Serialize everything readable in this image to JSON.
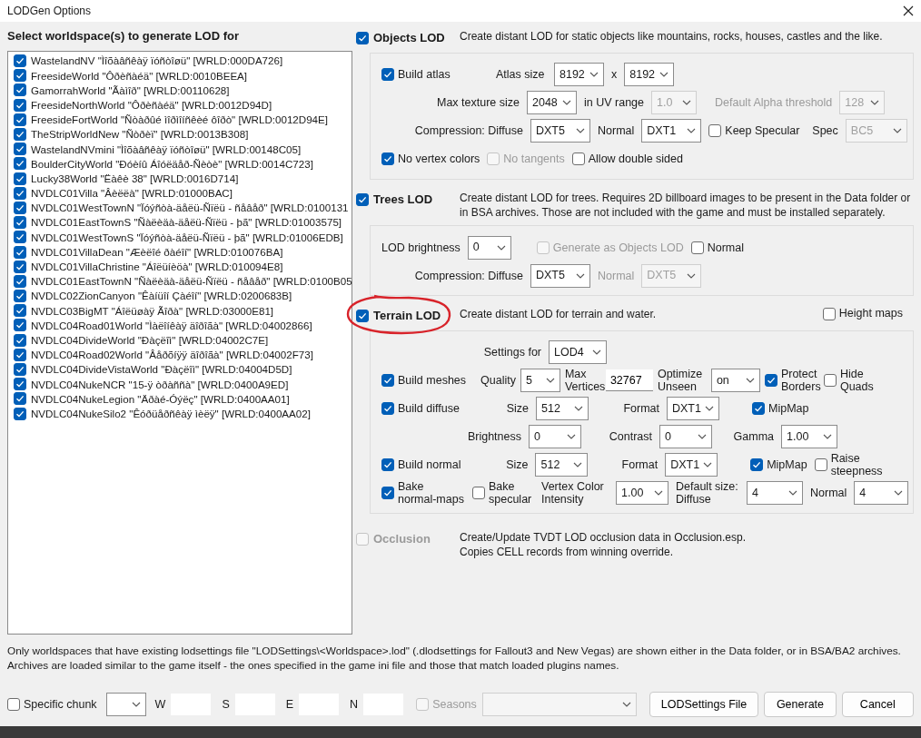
{
  "window": {
    "title": "LODGen Options"
  },
  "worldspaces": {
    "heading": "Select worldspace(s) to generate LOD for",
    "items": [
      {
        "label": "WastelandNV \"Ìîõàâñêàÿ ïóñòîøü\" [WRLD:000DA726]",
        "checked": true
      },
      {
        "label": "FreesideWorld \"Ôðèñàéä\" [WRLD:0010BEEA]",
        "checked": true
      },
      {
        "label": "GamorrahWorld \"Ãàìîð\" [WRLD:00110628]",
        "checked": true
      },
      {
        "label": "FreesideNorthWorld \"Ôðèñàéä\" [WRLD:0012D94D]",
        "checked": true
      },
      {
        "label": "FreesideFortWorld \"Ñòàðûé ìîðìîíñêèé ôîðò\" [WRLD:0012D94E]",
        "checked": true
      },
      {
        "label": "TheStripWorldNew \"Ñòðèï\" [WRLD:0013B308]",
        "checked": true
      },
      {
        "label": "WastelandNVmini \"Ìîõàâñêàÿ ïóñòîøü\" [WRLD:00148C05]",
        "checked": true
      },
      {
        "label": "BoulderCityWorld \"Ðóèíû Áîóëäåð-Ñèòè\" [WRLD:0014C723]",
        "checked": true
      },
      {
        "label": "Lucky38World \"Ëàêè 38\" [WRLD:0016D714]",
        "checked": true
      },
      {
        "label": "NVDLC01Villa \"Âèëëà\" [WRLD:01000BAC]",
        "checked": true
      },
      {
        "label": "NVDLC01WestTownN \"Ïóýñòà-äåëü-Ñïëü - ñåâåð\" [WRLD:0100131",
        "checked": true
      },
      {
        "label": "NVDLC01EastTownS \"Ñàëèäà-äåëü-Ñïëü - þã\" [WRLD:01003575]",
        "checked": true
      },
      {
        "label": "NVDLC01WestTownS \"Ïóýñòà-äåëü-Ñïëü - þã\" [WRLD:01006EDB]",
        "checked": true
      },
      {
        "label": "NVDLC01VillaDean \"Æèëîé ðàéîí\" [WRLD:010076BA]",
        "checked": true
      },
      {
        "label": "NVDLC01VillaChristine \"Áîëüíèöà\" [WRLD:010094E8]",
        "checked": true
      },
      {
        "label": "NVDLC01EastTownN \"Ñàëèäà-äåëü-Ñïëü - ñåâåð\" [WRLD:0100B05",
        "checked": true
      },
      {
        "label": "NVDLC02ZionCanyon \"Êàíüîí Çàéîí\" [WRLD:0200683B]",
        "checked": true
      },
      {
        "label": "NVDLC03BigMT \"Áîëüøàÿ Ãîðà\" [WRLD:03000E81]",
        "checked": true
      },
      {
        "label": "NVDLC04Road01World \"Ìàëîíêàÿ äîðîãà\" [WRLD:04002866]",
        "checked": true
      },
      {
        "label": "NVDLC04DivideWorld \"Ðàçëîì\" [WRLD:04002C7E]",
        "checked": true
      },
      {
        "label": "NVDLC04Road02World \"Âåðõíÿÿ äîðîãà\" [WRLD:04002F73]",
        "checked": true
      },
      {
        "label": "NVDLC04DivideVistaWorld \"Ðàçëîì\" [WRLD:04004D5D]",
        "checked": true
      },
      {
        "label": "NVDLC04NukeNCR \"15-ÿ òðàññà\" [WRLD:0400A9ED]",
        "checked": true
      },
      {
        "label": "NVDLC04NukeLegion \"Äðàé-Óýëç\" [WRLD:0400AA01]",
        "checked": true
      },
      {
        "label": "NVDLC04NukeSilo2 \"Êóðüåðñêàÿ ìèëÿ\" [WRLD:0400AA02]",
        "checked": true
      }
    ]
  },
  "sections": [
    {
      "title": "Objects LOD",
      "checked": true,
      "disabled": false,
      "description": [
        "Create distant LOD for static objects like mountains, rocks, houses, castles and the like."
      ],
      "lines": [
        {
          "controls": [
            {
              "kind": "check",
              "label": "Build atlas",
              "checked": true,
              "disabled": false
            },
            {
              "kind": "label",
              "text": "Atlas size",
              "disabled": false
            },
            {
              "kind": "select",
              "value": "8192",
              "disabled": false
            },
            {
              "kind": "label",
              "text": "x",
              "disabled": false
            },
            {
              "kind": "select",
              "value": "8192",
              "disabled": false
            }
          ]
        },
        {
          "controls": [
            {
              "kind": "label",
              "text": "Max texture size",
              "disabled": false
            },
            {
              "kind": "select",
              "value": "2048",
              "disabled": false
            },
            {
              "kind": "label",
              "text": "in UV range",
              "disabled": false
            },
            {
              "kind": "select",
              "value": "1.0",
              "disabled": true
            },
            {
              "kind": "label",
              "text": "Default Alpha threshold",
              "disabled": true
            },
            {
              "kind": "select",
              "value": "128",
              "disabled": true
            }
          ]
        },
        {
          "controls": [
            {
              "kind": "label",
              "text": "Compression: Diffuse",
              "disabled": false
            },
            {
              "kind": "select",
              "value": "DXT5",
              "disabled": false
            },
            {
              "kind": "label",
              "text": "Normal",
              "disabled": false
            },
            {
              "kind": "select",
              "value": "DXT1",
              "disabled": false
            },
            {
              "kind": "check",
              "label": "Keep Specular",
              "checked": false,
              "disabled": false
            },
            {
              "kind": "label",
              "text": "Spec",
              "disabled": false
            },
            {
              "kind": "select",
              "value": "BC5",
              "disabled": true
            }
          ]
        },
        {
          "controls": [
            {
              "kind": "check",
              "label": "No vertex colors",
              "checked": true,
              "disabled": false
            },
            {
              "kind": "check",
              "label": "No tangents",
              "checked": false,
              "disabled": true
            },
            {
              "kind": "check",
              "label": "Allow double sided",
              "checked": false,
              "disabled": false
            }
          ]
        }
      ]
    },
    {
      "title": "Trees LOD",
      "checked": true,
      "disabled": false,
      "description": [
        "Create distant LOD for trees. Requires 2D billboard images to be present in the Data folder or in BSA archives. Those are not included with the game and must be installed separately."
      ],
      "lines": [
        {
          "controls": [
            {
              "kind": "label",
              "text": "LOD brightness",
              "disabled": false
            },
            {
              "kind": "select",
              "value": "0",
              "disabled": false
            },
            {
              "kind": "check",
              "label": "Generate as Objects LOD",
              "checked": false,
              "disabled": true
            },
            {
              "kind": "check",
              "label": "Normal",
              "checked": false,
              "disabled": false
            }
          ]
        },
        {
          "controls": [
            {
              "kind": "label",
              "text": "Compression: Diffuse",
              "disabled": false
            },
            {
              "kind": "select",
              "value": "DXT5",
              "disabled": false
            },
            {
              "kind": "label",
              "text": "Normal",
              "disabled": true
            },
            {
              "kind": "select",
              "value": "DXT5",
              "disabled": true
            }
          ]
        }
      ]
    },
    {
      "title": "Terrain LOD",
      "checked": true,
      "disabled": false,
      "description": [
        "Create distant LOD for terrain and water."
      ],
      "option": {
        "label": "Height maps",
        "checked": false
      },
      "lines": [
        {
          "controls": [
            {
              "kind": "label",
              "text": "Settings for",
              "disabled": false
            },
            {
              "kind": "select",
              "value": "LOD4",
              "disabled": false
            }
          ]
        },
        {
          "controls": [
            {
              "kind": "check",
              "label": "Build meshes",
              "checked": true,
              "disabled": false
            },
            {
              "kind": "label",
              "text": "Quality",
              "disabled": false
            },
            {
              "kind": "select",
              "value": "5",
              "disabled": false
            },
            {
              "kind": "label",
              "text": "Max Vertices",
              "disabled": false
            },
            {
              "kind": "input",
              "value": "32767",
              "disabled": false
            },
            {
              "kind": "label",
              "text": "Optimize Unseen",
              "disabled": false
            },
            {
              "kind": "select",
              "value": "on",
              "disabled": false
            },
            {
              "kind": "check",
              "label": "Protect Borders",
              "checked": true,
              "disabled": false
            },
            {
              "kind": "check",
              "label": "Hide Quads",
              "checked": false,
              "disabled": false
            }
          ]
        },
        {
          "controls": [
            {
              "kind": "check",
              "label": "Build diffuse",
              "checked": true,
              "disabled": false
            },
            {
              "kind": "label",
              "text": "Size",
              "disabled": false
            },
            {
              "kind": "select",
              "value": "512",
              "disabled": false
            },
            {
              "kind": "label",
              "text": "Format",
              "disabled": false
            },
            {
              "kind": "select",
              "value": "DXT1",
              "disabled": false
            },
            {
              "kind": "check",
              "label": "MipMap",
              "checked": true,
              "disabled": false
            }
          ]
        },
        {
          "controls": [
            {
              "kind": "label",
              "text": "Brightness",
              "disabled": false
            },
            {
              "kind": "select",
              "value": "0",
              "disabled": false
            },
            {
              "kind": "label",
              "text": "Contrast",
              "disabled": false
            },
            {
              "kind": "select",
              "value": "0",
              "disabled": false
            },
            {
              "kind": "label",
              "text": "Gamma",
              "disabled": false
            },
            {
              "kind": "select",
              "value": "1.00",
              "disabled": false
            }
          ]
        },
        {
          "controls": [
            {
              "kind": "check",
              "label": "Build normal",
              "checked": true,
              "disabled": false
            },
            {
              "kind": "label",
              "text": "Size",
              "disabled": false
            },
            {
              "kind": "select",
              "value": "512",
              "disabled": false
            },
            {
              "kind": "label",
              "text": "Format",
              "disabled": false
            },
            {
              "kind": "select",
              "value": "DXT1",
              "disabled": false
            },
            {
              "kind": "check",
              "label": "MipMap",
              "checked": true,
              "disabled": false
            },
            {
              "kind": "check",
              "label": "Raise steepness",
              "checked": false,
              "disabled": false
            }
          ]
        },
        {
          "controls": [
            {
              "kind": "check",
              "label": "Bake normal-maps",
              "checked": true,
              "disabled": false
            },
            {
              "kind": "check",
              "label": "Bake specular",
              "checked": false,
              "disabled": false
            },
            {
              "kind": "label",
              "text": "Vertex Color Intensity",
              "disabled": false
            },
            {
              "kind": "select",
              "value": "1.00",
              "disabled": false
            },
            {
              "kind": "label",
              "text": "Default size: Diffuse",
              "disabled": false
            },
            {
              "kind": "select",
              "value": "4",
              "disabled": false
            },
            {
              "kind": "label",
              "text": "Normal",
              "disabled": false
            },
            {
              "kind": "select",
              "value": "4",
              "disabled": false
            }
          ]
        }
      ]
    },
    {
      "title": "Occlusion",
      "checked": false,
      "disabled": true,
      "description": [
        "Create/Update TVDT LOD occlusion data in Occlusion.esp.",
        "Copies CELL records from winning override."
      ]
    }
  ],
  "note": [
    "Only worldspaces that have existing lodsettings file \"LODSettings\\<Worldspace>.lod\" (.dlodsettings for Fallout3 and New Vegas) are shown either in the Data folder, or in BSA/BA2 archives.",
    "Archives are loaded similar to the game itself - the ones specified in the game ini file and those that match loaded plugins names."
  ],
  "footer": [
    {
      "kind": "check",
      "label": "Specific chunk",
      "checked": false,
      "disabled": false
    },
    {
      "kind": "select",
      "disabled": false
    },
    {
      "kind": "label",
      "text": "W",
      "disabled": false
    },
    {
      "kind": "input",
      "disabled": false
    },
    {
      "kind": "label",
      "text": "S",
      "disabled": false
    },
    {
      "kind": "input",
      "disabled": false
    },
    {
      "kind": "label",
      "text": "E",
      "disabled": false
    },
    {
      "kind": "input",
      "disabled": false
    },
    {
      "kind": "label",
      "text": "N",
      "disabled": false
    },
    {
      "kind": "input",
      "disabled": false
    },
    {
      "kind": "check",
      "label": "Seasons",
      "checked": false,
      "disabled": true
    },
    {
      "kind": "select",
      "disabled": true
    },
    {
      "kind": "button",
      "label": "LODSettings File",
      "disabled": false
    },
    {
      "kind": "button",
      "label": "Generate",
      "disabled": false
    },
    {
      "kind": "button",
      "label": "Cancel",
      "disabled": false
    }
  ]
}
